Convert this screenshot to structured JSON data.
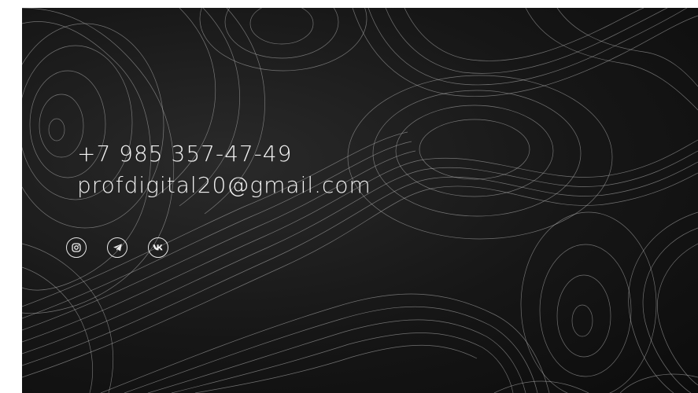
{
  "contacts": {
    "phone": "+7 985 357-47-49",
    "email": "profdigital20@gmail.com"
  },
  "socials": [
    {
      "icon": "instagram-icon"
    },
    {
      "icon": "telegram-icon"
    },
    {
      "icon": "vk-icon"
    }
  ],
  "colors": {
    "background": "#141414",
    "text": "#f2f2f2",
    "contour_lines": "#bdbdbd"
  }
}
